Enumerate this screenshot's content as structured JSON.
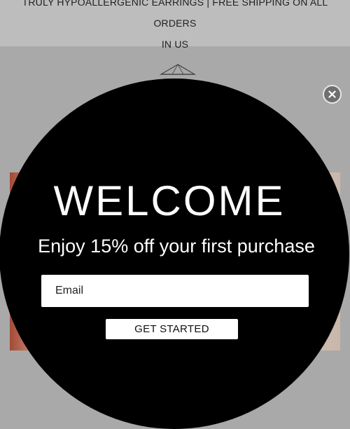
{
  "announcement": {
    "line1": "TRULY HYPOALLERGENIC EARRINGS | FREE SHIPPING ON ALL ORDERS",
    "line2": "IN US"
  },
  "header": {
    "logo_icon": "diamond-logo-icon"
  },
  "popup": {
    "title": "WELCOME",
    "subtitle": "Enjoy 15% off your first purchase",
    "email_placeholder": "Email",
    "email_value": "",
    "button_label": "GET STARTED",
    "close_icon": "close-icon"
  },
  "colors": {
    "popup_background": "#000000",
    "overlay": "#a9a9a9",
    "text_on_popup": "#ffffff",
    "close_button": "#6f6f6f"
  }
}
